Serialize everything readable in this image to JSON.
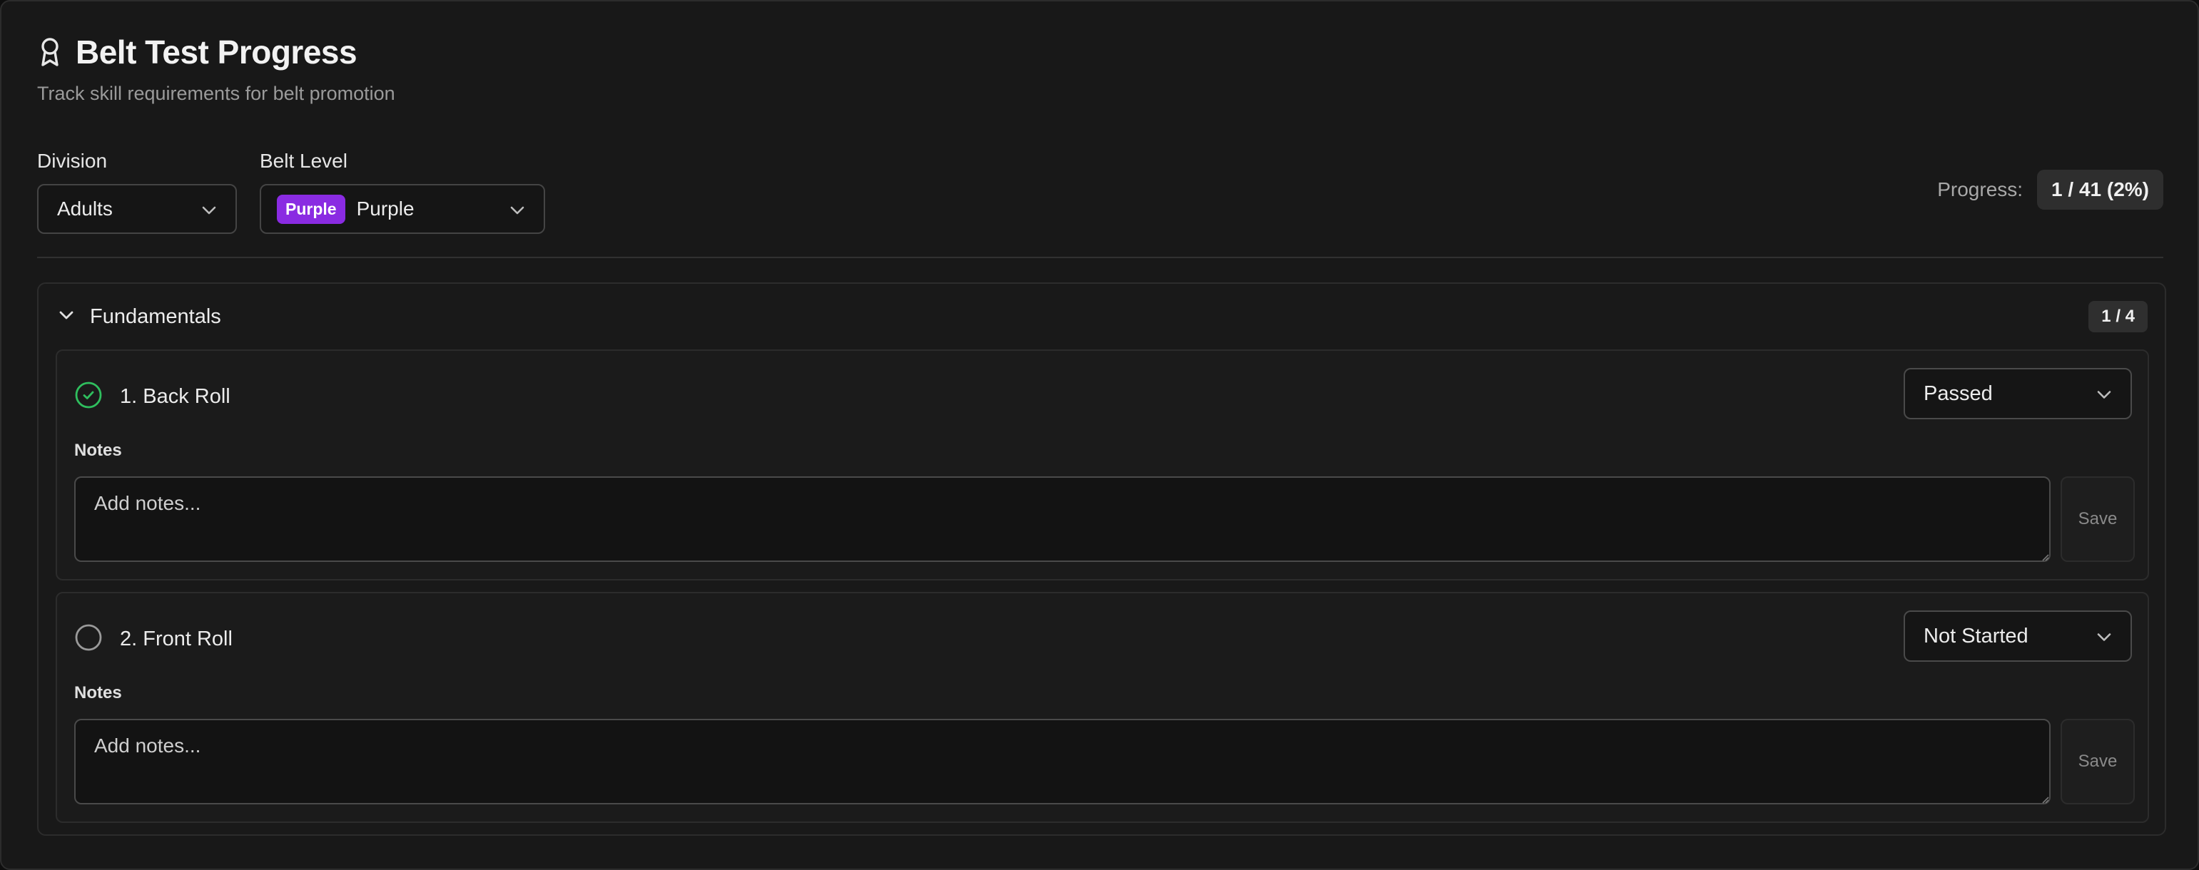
{
  "header": {
    "icon": "award-ribbon-icon",
    "title": "Belt Test Progress",
    "subtitle": "Track skill requirements for belt promotion"
  },
  "filters": {
    "division_label": "Division",
    "division_value": "Adults",
    "belt_label": "Belt Level",
    "belt_badge": "Purple",
    "belt_value": "Purple",
    "belt_badge_color": "#8a2be2"
  },
  "progress": {
    "label": "Progress:",
    "value": "1 / 41 (2%)",
    "completed": 1,
    "total": 41,
    "percent": 2
  },
  "section": {
    "title": "Fundamentals",
    "count": "1 / 4",
    "expanded": true,
    "skills": [
      {
        "name": "1. Back Roll",
        "status": "Passed",
        "status_icon": "check-circle-icon",
        "status_color": "#2fbf5e",
        "notes_label": "Notes",
        "notes_placeholder": "Add notes...",
        "save_label": "Save"
      },
      {
        "name": "2. Front Roll",
        "status": "Not Started",
        "status_icon": "empty-circle-icon",
        "status_color": "#9a9a9a",
        "notes_label": "Notes",
        "notes_placeholder": "Add notes...",
        "save_label": "Save"
      }
    ]
  }
}
